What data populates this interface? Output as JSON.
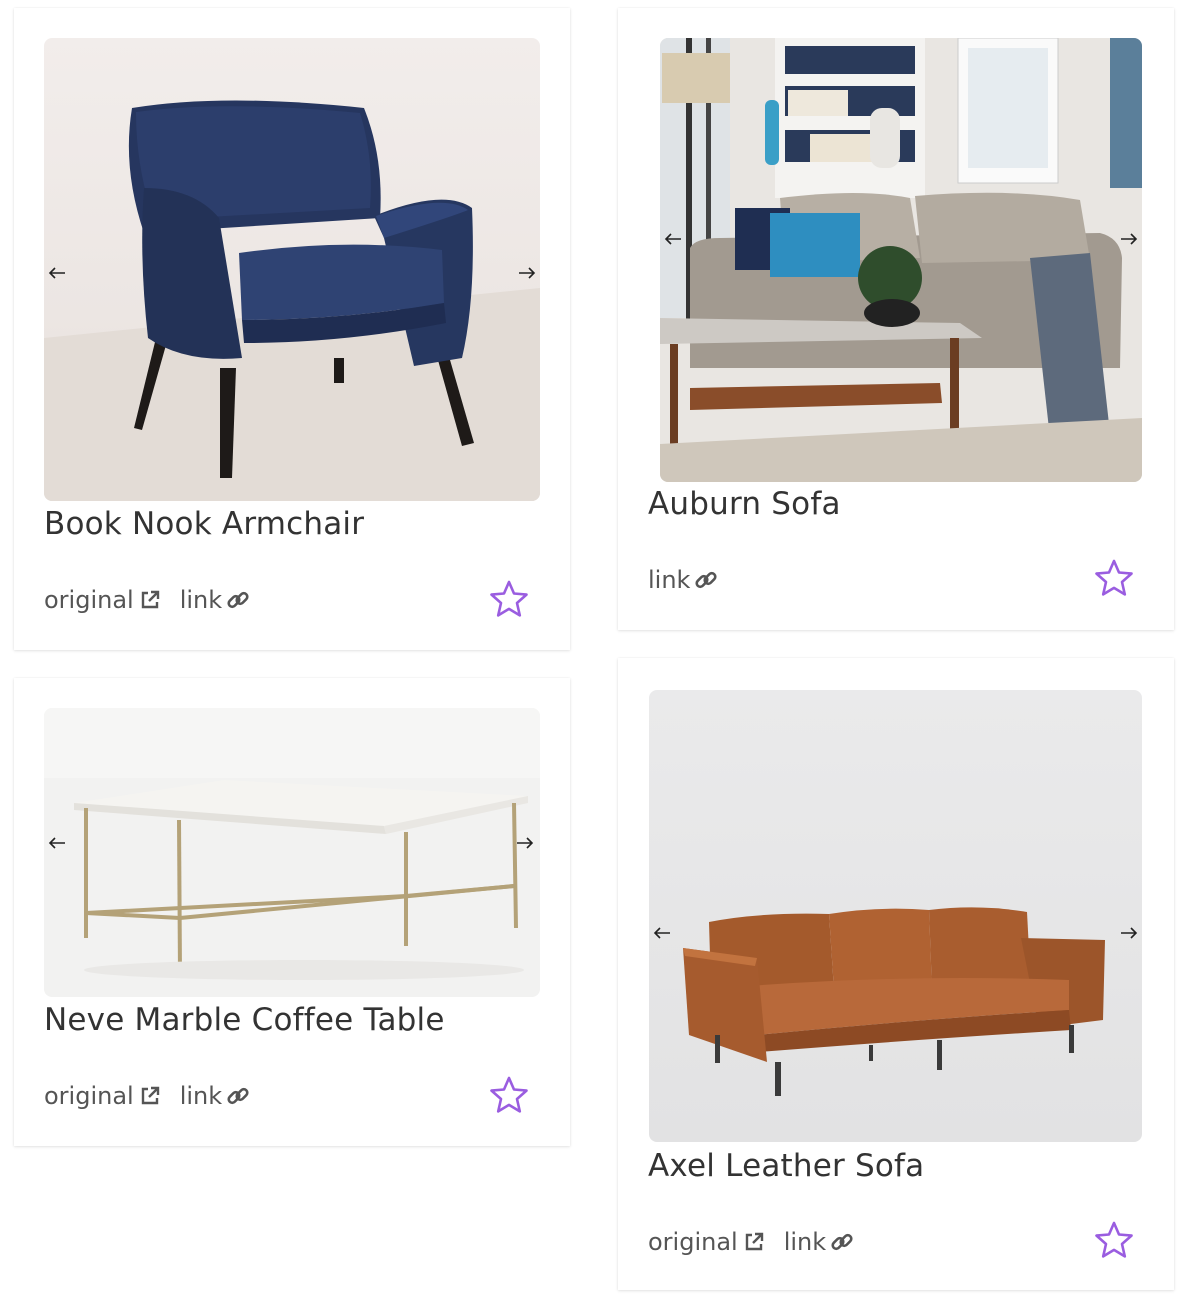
{
  "colors": {
    "accent": "#9a5de0",
    "text": "#333333",
    "muted": "#555555"
  },
  "labels": {
    "original": "original",
    "link": "link"
  },
  "products": [
    {
      "title": "Book Nook Armchair",
      "image": "navy-velvet-armchair-photo",
      "has_original": true
    },
    {
      "title": "Auburn Sofa",
      "image": "gray-sofa-living-room-photo",
      "has_original": false
    },
    {
      "title": "Neve Marble Coffee Table",
      "image": "marble-coffee-table-photo",
      "has_original": true
    },
    {
      "title": "Axel Leather Sofa",
      "image": "tan-leather-sofa-photo",
      "has_original": true
    }
  ]
}
